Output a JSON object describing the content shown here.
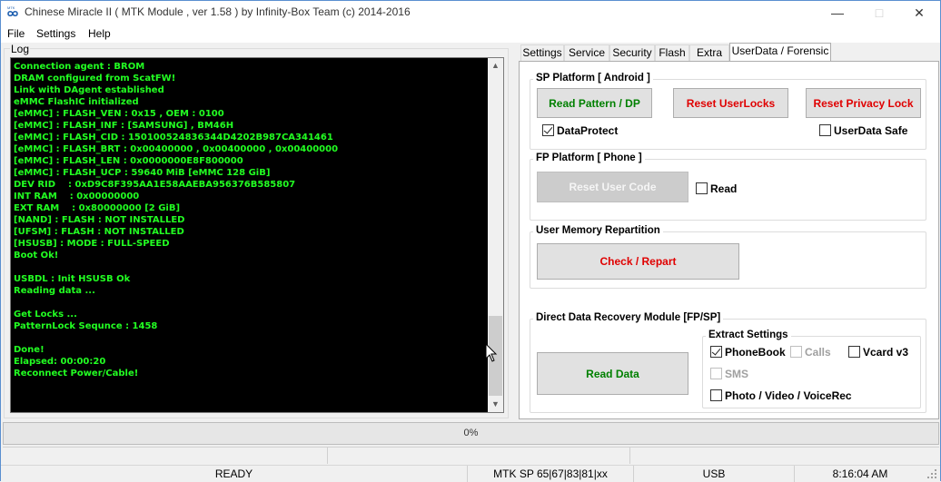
{
  "window": {
    "title": "Chinese Miracle II ( MTK Module , ver 1.58 ) by Infinity-Box Team (c) 2014-2016",
    "icon_label": "MTK"
  },
  "menu": [
    "File",
    "Settings",
    "Help"
  ],
  "log": {
    "label": "Log",
    "lines": [
      "Connection agent : BROM",
      "DRAM configured from ScatFW!",
      "Link with DAgent established",
      "eMMC FlashIC initialized",
      "[eMMC] : FLASH_VEN : 0x15 , OEM : 0100",
      "[eMMC] : FLASH_INF : [SAMSUNG] , BM46H",
      "[eMMC] : FLASH_CID : 150100524836344D4202B987CA341461",
      "[eMMC] : FLASH_BRT : 0x00400000 , 0x00400000 , 0x00400000",
      "[eMMC] : FLASH_LEN : 0x0000000E8F800000",
      "[eMMC] : FLASH_UCP : 59640 MiB [eMMC 128 GiB]",
      "DEV RID    : 0xD9C8F395AA1E58AAEBA956376B585807",
      "INT RAM    : 0x00000000",
      "EXT RAM    : 0x80000000 [2 GiB]",
      "[NAND] : FLASH : NOT INSTALLED",
      "[UFSM] : FLASH : NOT INSTALLED",
      "[HSUSB] : MODE : FULL-SPEED",
      "Boot Ok!",
      "",
      "USBDL : Init HSUSB Ok",
      "Reading data ...",
      "",
      "Get Locks ...",
      "PatternLock Sequnce : 1458",
      "",
      "Done!",
      "Elapsed: 00:00:20",
      "Reconnect Power/Cable!"
    ],
    "scroll_position": 0.8
  },
  "tabs": [
    "Settings",
    "Service",
    "Security",
    "Flash",
    "Extra",
    "UserData / Forensic"
  ],
  "active_tab": "UserData / Forensic",
  "sp_platform": {
    "label": "SP Platform [ Android ]",
    "read_pattern": "Read Pattern / DP",
    "reset_userlocks": "Reset UserLocks",
    "reset_privacy": "Reset Privacy Lock",
    "dataprotect": "DataProtect",
    "dataprotect_checked": true,
    "userdata_safe": "UserData Safe",
    "userdata_safe_checked": false
  },
  "fp_platform": {
    "label": "FP Platform [ Phone ]",
    "reset_user_code": "Reset User Code",
    "read": "Read",
    "read_checked": false
  },
  "repartition": {
    "label": "User Memory Repartition",
    "check_repart": "Check / Repart"
  },
  "recovery": {
    "label": "Direct Data Recovery Module  [FP/SP]",
    "read_data": "Read Data",
    "extract_label": "Extract Settings",
    "phonebook": "PhoneBook",
    "phonebook_checked": true,
    "calls": "Calls",
    "vcard": "Vcard v3",
    "vcard_checked": false,
    "sms": "SMS",
    "photo": "Photo / Video / VoiceRec",
    "photo_checked": false
  },
  "progress": {
    "text": "0%",
    "value": 0
  },
  "status": {
    "state": "READY",
    "platform": "MTK SP 65|67|83|81|xx",
    "connection": "USB",
    "time": "8:16:04 AM"
  },
  "colors": {
    "log_bg": "#000000",
    "log_text": "#22ff22",
    "green_button": "#008000",
    "red_button": "#e00000"
  }
}
